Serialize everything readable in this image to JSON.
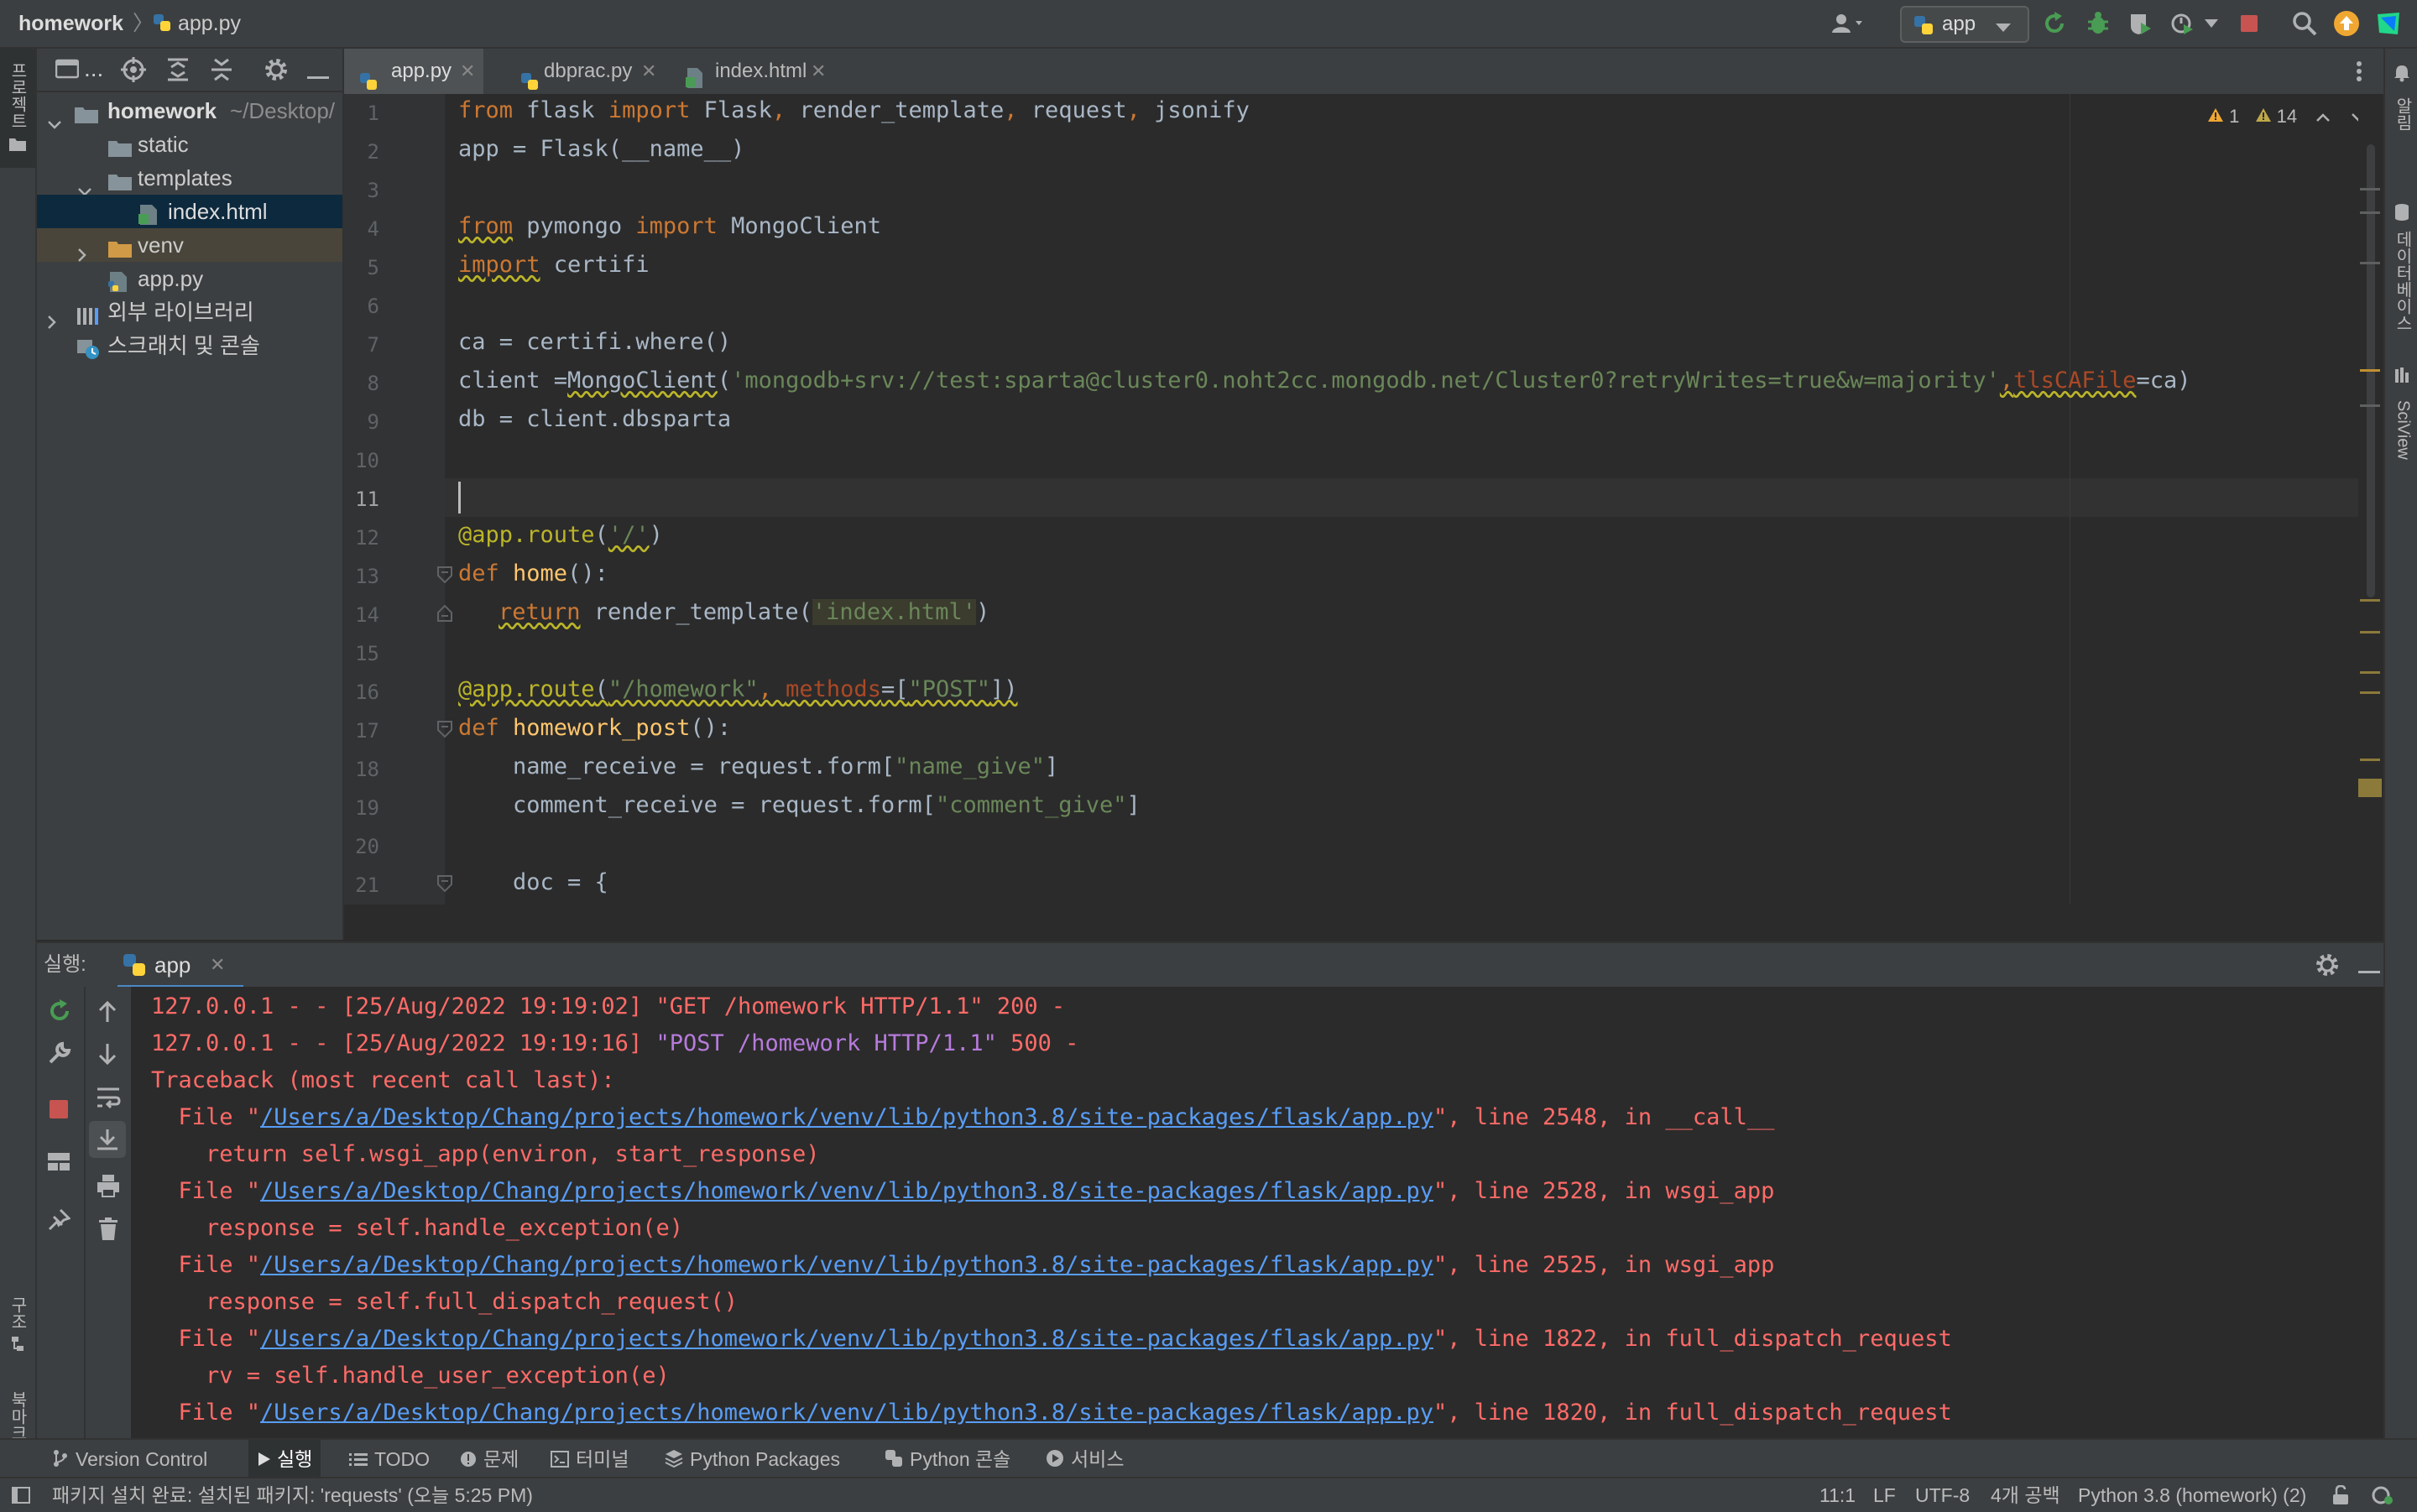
{
  "navbar": {
    "project_name": "homework",
    "file_name": "app.py",
    "run_config": "app"
  },
  "left_strip": {
    "project_label": "프로젝트",
    "structure_label": "구조",
    "bookmarks_label": "북마크"
  },
  "right_strip": {
    "notifications_label": "알림",
    "database_label": "데이터베이스",
    "sciview_label": "SciView"
  },
  "project_tree": {
    "toolbar_label": "...",
    "items": [
      {
        "label": "homework",
        "hint": "~/Desktop/"
      },
      {
        "label": "static"
      },
      {
        "label": "templates"
      },
      {
        "label": "index.html"
      },
      {
        "label": "venv"
      },
      {
        "label": "app.py"
      },
      {
        "label": "외부 라이브러리"
      },
      {
        "label": "스크래치 및 콘솔"
      }
    ]
  },
  "editor": {
    "tabs": [
      {
        "label": "app.py"
      },
      {
        "label": "dbprac.py"
      },
      {
        "label": "index.html"
      }
    ],
    "warnings_count": "1",
    "weak_warnings_count": "14",
    "line_numbers": [
      "1",
      "2",
      "3",
      "4",
      "5",
      "6",
      "7",
      "8",
      "9",
      "10",
      "11",
      "12",
      "13",
      "14",
      "15",
      "16",
      "17",
      "18",
      "19",
      "20",
      "21"
    ],
    "code": {
      "l1_a": "from",
      "l1_b": " flask ",
      "l1_c": "import",
      "l1_d": " Flask",
      "l1_e": ",",
      "l1_f": " render_template",
      "l1_g": ",",
      "l1_h": " request",
      "l1_i": ",",
      "l1_j": " jsonify",
      "l2": "app = Flask(__name__)",
      "l4_a": "from",
      "l4_b": " pymongo ",
      "l4_c": "import",
      "l4_d": " MongoClient",
      "l5_a": "import",
      "l5_b": " certifi",
      "l7": "ca = certifi.where()",
      "l8_a": "client =",
      "l8_b": "MongoClient",
      "l8_c": "(",
      "l8_d": "'mongodb+srv://test:sparta@cluster0.noht2cc.mongodb.net/Cluster0?retryWrites=true&w=majority'",
      "l8_e": ",",
      "l8_f": "tlsCAFile",
      "l8_g": "=ca)",
      "l9": "db = client.dbsparta",
      "l12_a": "@app.route",
      "l12_b": "(",
      "l12_c": "'/'",
      "l12_d": ")",
      "l13_a": "def",
      "l13_b": " home",
      "l13_c": "():",
      "l14_a": "return",
      "l14_b": " render_template(",
      "l14_c": "'index.html'",
      "l14_d": ")",
      "l16_a": "@app.route",
      "l16_b": "(",
      "l16_c": "\"/homework\"",
      "l16_d": ", ",
      "l16_e": "methods",
      "l16_f": "=[",
      "l16_g": "\"POST\"",
      "l16_h": "])",
      "l17_a": "def",
      "l17_b": " homework_post",
      "l17_c": "():",
      "l18_a": "    name_receive = request.form[",
      "l18_b": "\"name_give\"",
      "l18_c": "]",
      "l19_a": "    comment_receive = request.form[",
      "l19_b": "\"comment_give\"",
      "l19_c": "]",
      "l21": "    doc = {"
    }
  },
  "run_panel": {
    "title": "실행:",
    "tab_label": "app",
    "output": {
      "o1": "127.0.0.1 - - [25/Aug/2022 19:19:02] \"GET /homework HTTP/1.1\" 200 -",
      "o2_a": "127.0.0.1 - - [25/Aug/2022 19:19:16] ",
      "o2_b": "\"POST /homework HTTP/1.1\"",
      "o2_c": " 500 -",
      "o3": "Traceback (most recent call last):",
      "file_prefix": "  File \"",
      "path": "/Users/a/Desktop/Chang/projects/homework/venv/lib/python3.8/site-packages/flask/app.py",
      "o4_tail": "\", line 2548, in __call__",
      "o5": "    return self.wsgi_app(environ, start_response)",
      "o6_tail": "\", line 2528, in wsgi_app",
      "o7": "    response = self.handle_exception(e)",
      "o8_tail": "\", line 2525, in wsgi_app",
      "o9": "    response = self.full_dispatch_request()",
      "o10_tail": "\", line 1822, in full_dispatch_request",
      "o11": "    rv = self.handle_user_exception(e)",
      "o12_tail": "\", line 1820, in full_dispatch_request"
    }
  },
  "tool_tabs": [
    {
      "label": "Version Control"
    },
    {
      "label": "실행"
    },
    {
      "label": "TODO"
    },
    {
      "label": "문제"
    },
    {
      "label": "터미널"
    },
    {
      "label": "Python Packages"
    },
    {
      "label": "Python 콘솔"
    },
    {
      "label": "서비스"
    }
  ],
  "status_bar": {
    "message": "패키지 설치 완료: 설치된 패키지: 'requests' (오늘 5:25 PM)",
    "position": "11:1",
    "line_sep": "LF",
    "encoding": "UTF-8",
    "indent": "4개 공백",
    "interpreter": "Python 3.8 (homework) (2)"
  },
  "colors": {
    "accent_blue": "#3592c4",
    "error_red": "#ff6b68",
    "run_green": "#499c54",
    "warning_yellow": "#e8a838"
  }
}
